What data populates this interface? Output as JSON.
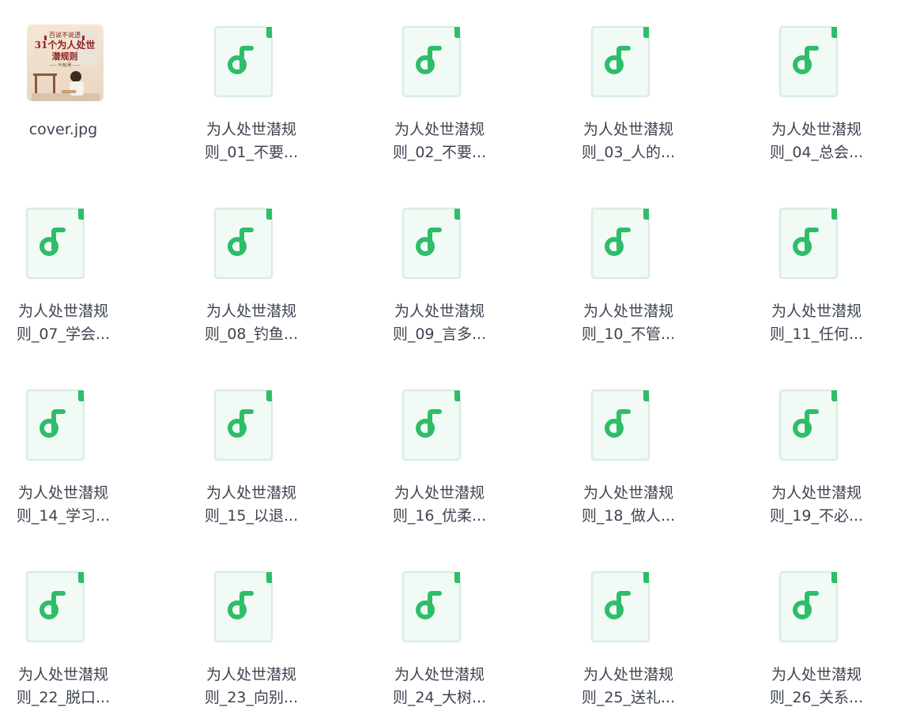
{
  "colors": {
    "doc_bg": "#f2faf5",
    "doc_border": "#d9eee2",
    "accent": "#2ebd69",
    "text": "#3d4351"
  },
  "files": [
    {
      "type": "image",
      "icon": "image-thumbnail",
      "line1": "cover.jpg",
      "line2": ""
    },
    {
      "type": "audio",
      "icon": "music-file-icon",
      "line1": "为人处世潜规",
      "line2": "则_01_不要..."
    },
    {
      "type": "audio",
      "icon": "music-file-icon",
      "line1": "为人处世潜规",
      "line2": "则_02_不要..."
    },
    {
      "type": "audio",
      "icon": "music-file-icon",
      "line1": "为人处世潜规",
      "line2": "则_03_人的..."
    },
    {
      "type": "audio",
      "icon": "music-file-icon",
      "line1": "为人处世潜规",
      "line2": "则_04_总会..."
    },
    {
      "type": "audio",
      "icon": "music-file-icon",
      "line1": "为人处世潜规",
      "line2": "则_07_学会..."
    },
    {
      "type": "audio",
      "icon": "music-file-icon",
      "line1": "为人处世潜规",
      "line2": "则_08_钓鱼..."
    },
    {
      "type": "audio",
      "icon": "music-file-icon",
      "line1": "为人处世潜规",
      "line2": "则_09_言多..."
    },
    {
      "type": "audio",
      "icon": "music-file-icon",
      "line1": "为人处世潜规",
      "line2": "则_10_不管..."
    },
    {
      "type": "audio",
      "icon": "music-file-icon",
      "line1": "为人处世潜规",
      "line2": "则_11_任何..."
    },
    {
      "type": "audio",
      "icon": "music-file-icon",
      "line1": "为人处世潜规",
      "line2": "则_14_学习..."
    },
    {
      "type": "audio",
      "icon": "music-file-icon",
      "line1": "为人处世潜规",
      "line2": "则_15_以退..."
    },
    {
      "type": "audio",
      "icon": "music-file-icon",
      "line1": "为人处世潜规",
      "line2": "则_16_优柔..."
    },
    {
      "type": "audio",
      "icon": "music-file-icon",
      "line1": "为人处世潜规",
      "line2": "则_18_做人..."
    },
    {
      "type": "audio",
      "icon": "music-file-icon",
      "line1": "为人处世潜规",
      "line2": "则_19_不必..."
    },
    {
      "type": "audio",
      "icon": "music-file-icon",
      "line1": "为人处世潜规",
      "line2": "则_22_脱口..."
    },
    {
      "type": "audio",
      "icon": "music-file-icon",
      "line1": "为人处世潜规",
      "line2": "则_23_向别..."
    },
    {
      "type": "audio",
      "icon": "music-file-icon",
      "line1": "为人处世潜规",
      "line2": "则_24_大树..."
    },
    {
      "type": "audio",
      "icon": "music-file-icon",
      "line1": "为人处世潜规",
      "line2": "则_25_送礼..."
    },
    {
      "type": "audio",
      "icon": "music-file-icon",
      "line1": "为人处世潜规",
      "line2": "则_26_关系..."
    }
  ],
  "cover_art": {
    "title_lines": [
      "百说不说透",
      "31个为人处世",
      "潜规则"
    ],
    "subtitle": "—— 叶萌/著 ——"
  }
}
